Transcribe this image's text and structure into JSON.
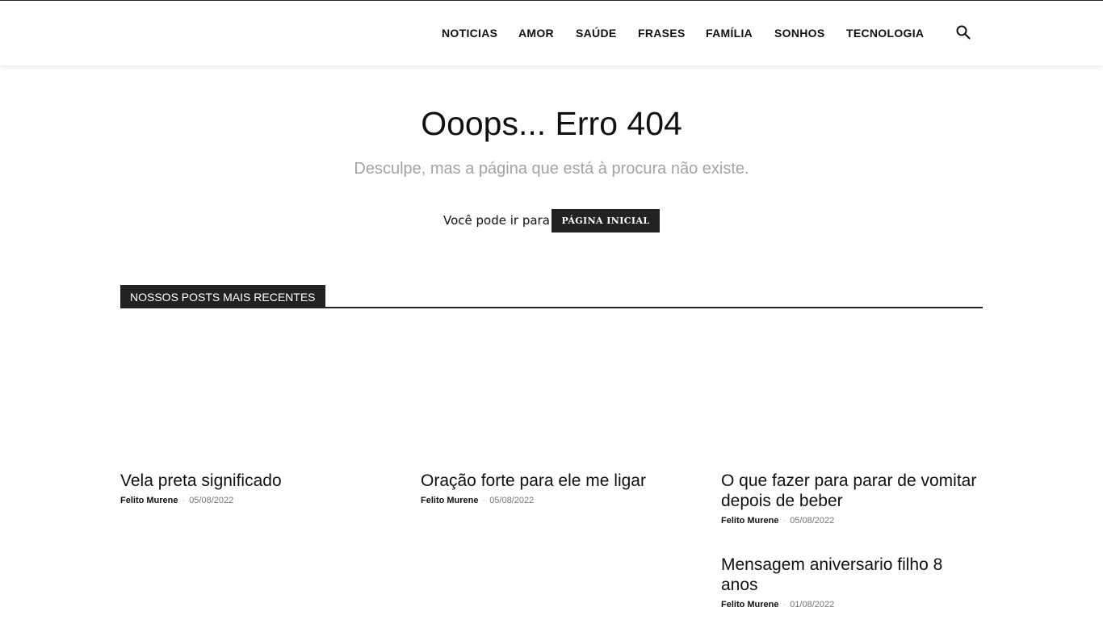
{
  "nav": {
    "items": [
      {
        "label": "NOTICIAS"
      },
      {
        "label": "AMOR"
      },
      {
        "label": "SAÚDE"
      },
      {
        "label": "FRASES"
      },
      {
        "label": "FAMÍLIA"
      },
      {
        "label": "SONHOS"
      },
      {
        "label": "TECNOLOGIA"
      }
    ],
    "search_icon": "search-icon"
  },
  "error": {
    "title": "Ooops... Erro 404",
    "subtitle": "Desculpe, mas a página que está à procura não existe.",
    "goto_label": "Você pode ir para",
    "home_button": "PÁGINA INICIAL"
  },
  "recent": {
    "heading": "NOSSOS POSTS MAIS RECENTES",
    "posts": [
      {
        "title": "Vela preta significado",
        "author": "Felito Murene",
        "separator": "-",
        "date": "05/08/2022"
      },
      {
        "title": "Oração forte para ele me ligar",
        "author": "Felito Murene",
        "separator": "-",
        "date": "05/08/2022"
      },
      {
        "title": "O que fazer para parar de vomitar depois de beber",
        "author": "Felito Murene",
        "separator": "-",
        "date": "05/08/2022"
      },
      {
        "title": "Mensagem aniversario filho 8 anos",
        "author": "Felito Murene",
        "separator": "-",
        "date": "01/08/2022"
      }
    ]
  },
  "colors": {
    "accent": "#222222",
    "subtitle": "#a3a3a3",
    "date": "#767676"
  }
}
